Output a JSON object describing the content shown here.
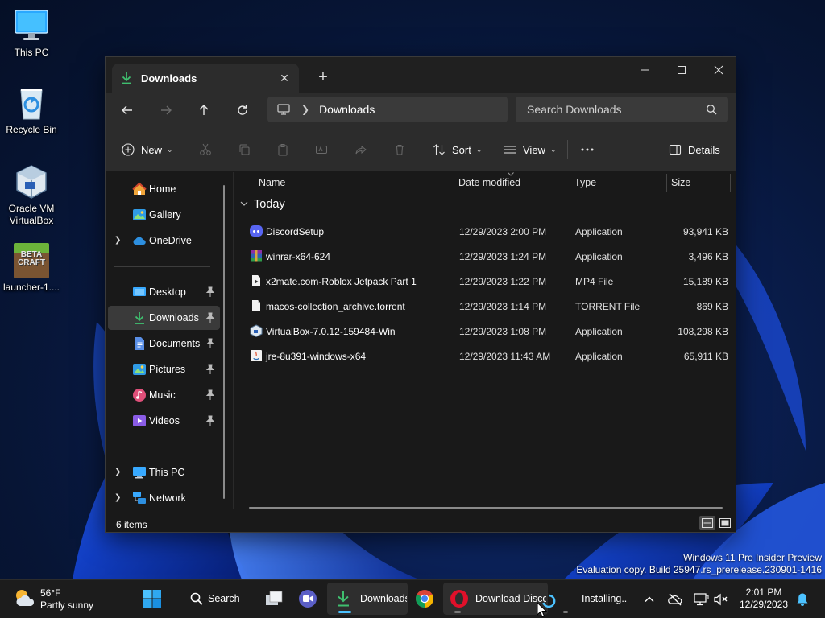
{
  "desktop": {
    "icons": [
      {
        "label": "This PC"
      },
      {
        "label": "Recycle Bin"
      },
      {
        "label": "Oracle VM VirtualBox"
      },
      {
        "label": "launcher-1...."
      }
    ],
    "launcher_logo_text": "BETA CRAFT"
  },
  "explorer": {
    "tab": {
      "label": "Downloads"
    },
    "address": {
      "crumb": "Downloads"
    },
    "search": {
      "placeholder": "Search Downloads"
    },
    "commands": {
      "new": "New",
      "sort": "Sort",
      "view": "View",
      "details": "Details"
    },
    "sidebar": {
      "top": [
        {
          "label": "Home"
        },
        {
          "label": "Gallery"
        },
        {
          "label": "OneDrive"
        }
      ],
      "pinned": [
        {
          "label": "Desktop"
        },
        {
          "label": "Downloads"
        },
        {
          "label": "Documents"
        },
        {
          "label": "Pictures"
        },
        {
          "label": "Music"
        },
        {
          "label": "Videos"
        }
      ],
      "bottom": [
        {
          "label": "This PC"
        },
        {
          "label": "Network"
        }
      ],
      "selected": "Downloads"
    },
    "columns": {
      "name": "Name",
      "date": "Date modified",
      "type": "Type",
      "size": "Size"
    },
    "group": "Today",
    "files": [
      {
        "name": "DiscordSetup",
        "date": "12/29/2023 2:00 PM",
        "type": "Application",
        "size": "93,941 KB",
        "icon": "discord-icon"
      },
      {
        "name": "winrar-x64-624",
        "date": "12/29/2023 1:24 PM",
        "type": "Application",
        "size": "3,496 KB",
        "icon": "winrar-icon"
      },
      {
        "name": "x2mate.com-Roblox Jetpack Part 1",
        "date": "12/29/2023 1:22 PM",
        "type": "MP4 File",
        "size": "15,189 KB",
        "icon": "video-file-icon"
      },
      {
        "name": "macos-collection_archive.torrent",
        "date": "12/29/2023 1:14 PM",
        "type": "TORRENT File",
        "size": "869 KB",
        "icon": "blank-file-icon"
      },
      {
        "name": "VirtualBox-7.0.12-159484-Win",
        "date": "12/29/2023 1:08 PM",
        "type": "Application",
        "size": "108,298 KB",
        "icon": "virtualbox-icon"
      },
      {
        "name": "jre-8u391-windows-x64",
        "date": "12/29/2023 11:43 AM",
        "type": "Application",
        "size": "65,911 KB",
        "icon": "java-icon"
      }
    ],
    "status": {
      "count": "6 items"
    }
  },
  "watermark": {
    "line1": "Windows 11 Pro Insider Preview",
    "line2": "Evaluation copy. Build 25947.rs_prerelease.230901-1416"
  },
  "taskbar": {
    "weather": {
      "temp": "56°F",
      "desc": "Partly sunny"
    },
    "search_label": "Search",
    "apps": {
      "explorer": "Downloads",
      "opera": "Download Disco",
      "installer": "Installing.."
    },
    "clock": {
      "time": "2:01 PM",
      "date": "12/29/2023"
    }
  },
  "colors": {
    "accent": "#4cc2ff",
    "download_green": "#3fbf6f",
    "selected_bg": "#3a3a3a"
  }
}
